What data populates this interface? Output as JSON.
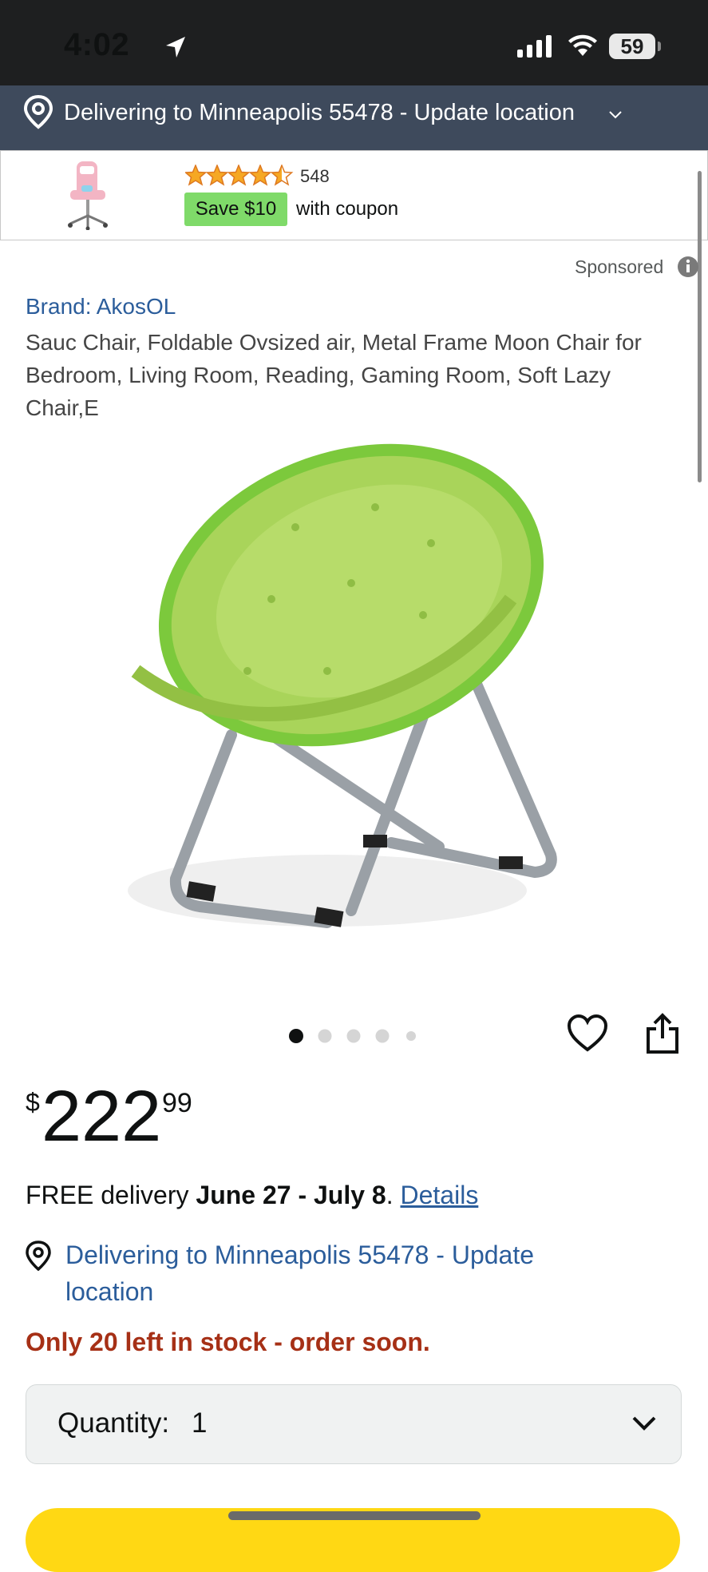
{
  "status_bar": {
    "time": "4:02",
    "battery": "59"
  },
  "delivery_banner": {
    "text": "Delivering to Minneapolis 55478 - Update location"
  },
  "sponsored_card": {
    "rating": 4.5,
    "review_count": "548",
    "coupon_badge": "Save $10",
    "coupon_text": "with coupon"
  },
  "sponsored_label": "Sponsored",
  "product": {
    "brand": "Brand: AkosOL",
    "title": "Sauc Chair, Foldable Ovsized air, Metal Frame Moon Chair for Bedroom, Living Room, Reading, Gaming Room, Soft Lazy Chair,E",
    "image_count": 5,
    "active_image_index": 0
  },
  "price": {
    "symbol": "$",
    "whole": "222",
    "fraction": "99"
  },
  "delivery": {
    "prefix": "FREE delivery ",
    "dates": "June 27 - July 8",
    "suffix": ". ",
    "details_link": "Details",
    "location_link": "Delivering to Minneapolis 55478 - Update location"
  },
  "stock": "Only 20 left in stock - order soon.",
  "quantity": {
    "label": "Quantity:",
    "value": "1"
  },
  "colors": {
    "link_blue": "#2b5d9b",
    "stock_red": "#a63016",
    "coupon_green": "#7fda69",
    "cart_yellow": "#ffd814",
    "banner": "#3e4a5c"
  }
}
